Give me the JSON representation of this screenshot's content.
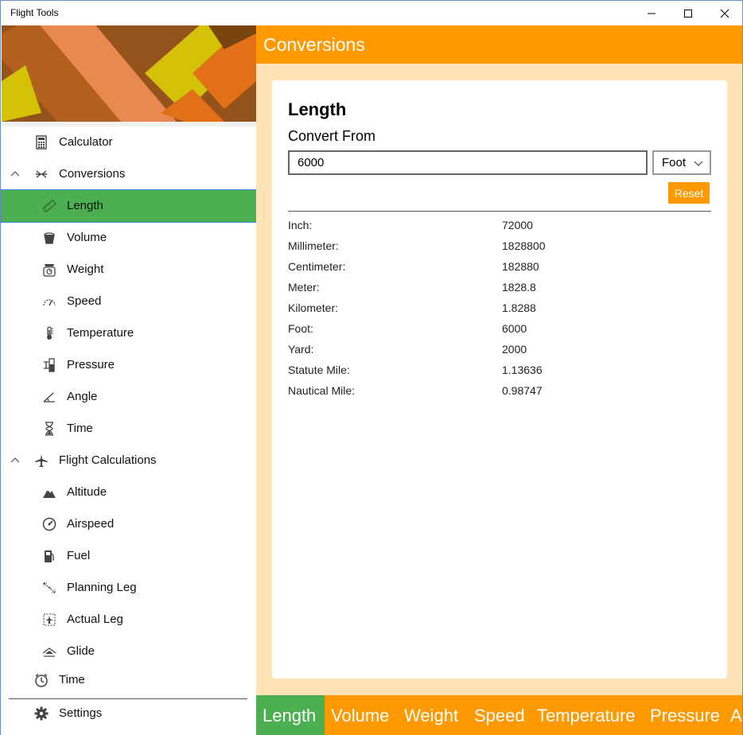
{
  "window": {
    "title": "Flight Tools"
  },
  "sidebar": {
    "items": [
      {
        "label": "Calculator",
        "icon": "calculator-icon"
      },
      {
        "label": "Conversions",
        "icon": "conversions-icon",
        "expanded": true
      },
      {
        "label": "Length",
        "icon": "ruler-icon",
        "selected": true
      },
      {
        "label": "Volume",
        "icon": "bucket-icon"
      },
      {
        "label": "Weight",
        "icon": "scale-icon"
      },
      {
        "label": "Speed",
        "icon": "speedometer-icon"
      },
      {
        "label": "Temperature",
        "icon": "thermometer-icon"
      },
      {
        "label": "Pressure",
        "icon": "pressure-icon"
      },
      {
        "label": "Angle",
        "icon": "angle-icon"
      },
      {
        "label": "Time",
        "icon": "hourglass-icon"
      },
      {
        "label": "Flight Calculations",
        "icon": "airplane-icon",
        "expanded": true
      },
      {
        "label": "Altitude",
        "icon": "mountain-icon"
      },
      {
        "label": "Airspeed",
        "icon": "gauge-icon"
      },
      {
        "label": "Fuel",
        "icon": "fuel-pump-icon"
      },
      {
        "label": "Planning Leg",
        "icon": "planning-leg-icon"
      },
      {
        "label": "Actual Leg",
        "icon": "actual-leg-icon"
      },
      {
        "label": "Glide",
        "icon": "glide-icon"
      },
      {
        "label": "Time",
        "icon": "clock-icon"
      },
      {
        "label": "Settings",
        "icon": "gear-icon"
      }
    ]
  },
  "header": {
    "title": "Conversions"
  },
  "card": {
    "title": "Length",
    "convert_from_label": "Convert From",
    "input_value": "6000",
    "unit_selected": "Foot",
    "reset_label": "Reset",
    "results": [
      {
        "unit": "Inch:",
        "value": "72000"
      },
      {
        "unit": "Millimeter:",
        "value": "1828800"
      },
      {
        "unit": "Centimeter:",
        "value": "182880"
      },
      {
        "unit": "Meter:",
        "value": "1828.8"
      },
      {
        "unit": "Kilometer:",
        "value": "1.8288"
      },
      {
        "unit": "Foot:",
        "value": "6000"
      },
      {
        "unit": "Yard:",
        "value": "2000"
      },
      {
        "unit": "Statute Mile:",
        "value": "1.13636"
      },
      {
        "unit": "Nautical Mile:",
        "value": "0.98747"
      }
    ]
  },
  "tabs": [
    {
      "label": "Length",
      "active": true
    },
    {
      "label": "Volume"
    },
    {
      "label": "Weight"
    },
    {
      "label": "Speed"
    },
    {
      "label": "Temperature"
    },
    {
      "label": "Pressure"
    },
    {
      "label": "A"
    }
  ],
  "colors": {
    "accent": "#ff9900",
    "selected": "#4caf50",
    "content_bg": "#ffe2b5"
  }
}
